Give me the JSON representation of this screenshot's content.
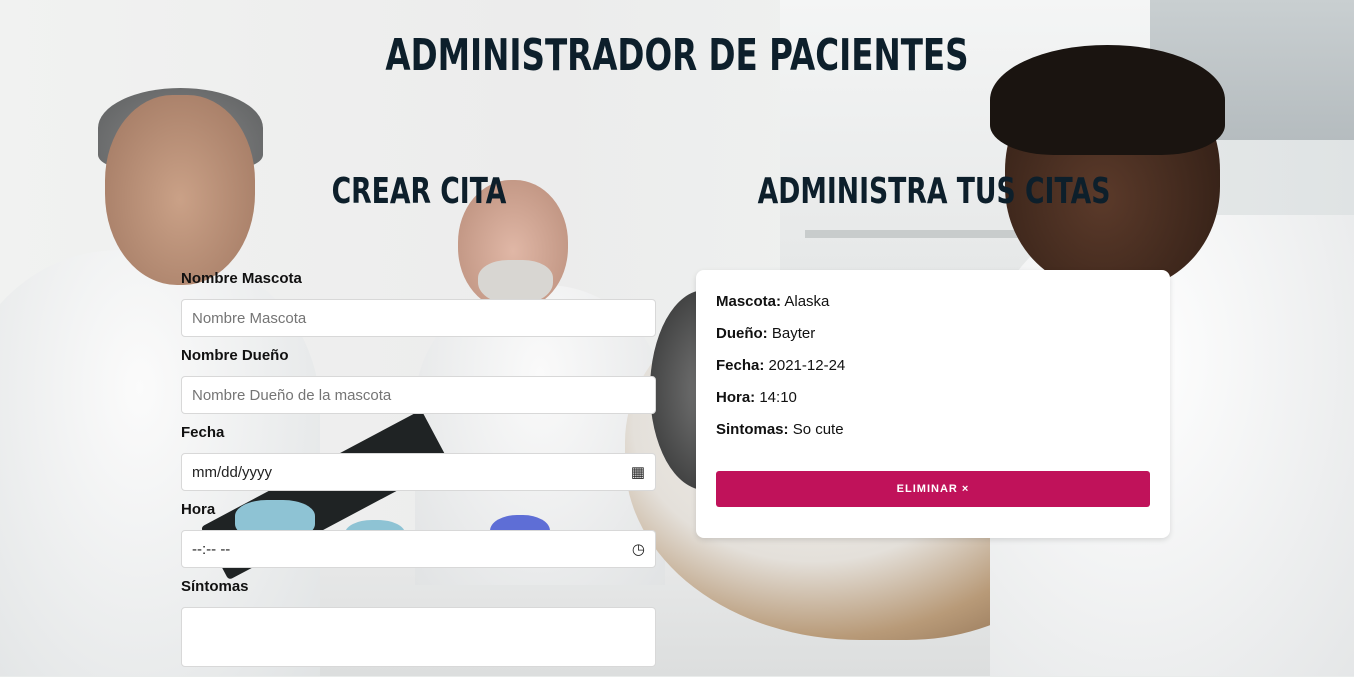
{
  "page": {
    "title": "Administrador de Pacientes"
  },
  "form": {
    "title": "Crear Cita",
    "fields": {
      "mascota": {
        "label": "Nombre Mascota",
        "placeholder": "Nombre Mascota"
      },
      "propietario": {
        "label": "Nombre Dueño",
        "placeholder": "Nombre  Dueño de la mascota"
      },
      "fecha": {
        "label": "Fecha",
        "placeholder": "mm/dd/yyyy",
        "icon": "calendar-icon",
        "icon_glyph": "▦"
      },
      "hora": {
        "label": "Hora",
        "placeholder": "--:-- --",
        "icon": "clock-icon",
        "icon_glyph": "◷"
      },
      "sintomas": {
        "label": "Síntomas",
        "placeholder": ""
      }
    }
  },
  "appointments": {
    "title": "Administra tus citas",
    "items": [
      {
        "mascota_label": "Mascota:",
        "mascota": "Alaska",
        "propietario_label": "Dueño:",
        "propietario": "Bayter",
        "fecha_label": "Fecha:",
        "fecha": "2021-12-24",
        "hora_label": "Hora:",
        "hora": "14:10",
        "sintomas_label": "Sintomas:",
        "sintomas": "So cute",
        "delete_label": "ELIMINAR ×"
      }
    ]
  },
  "colors": {
    "heading": "#0d1f2b",
    "delete_button": "#c0125a",
    "card_bg": "#ffffff"
  }
}
